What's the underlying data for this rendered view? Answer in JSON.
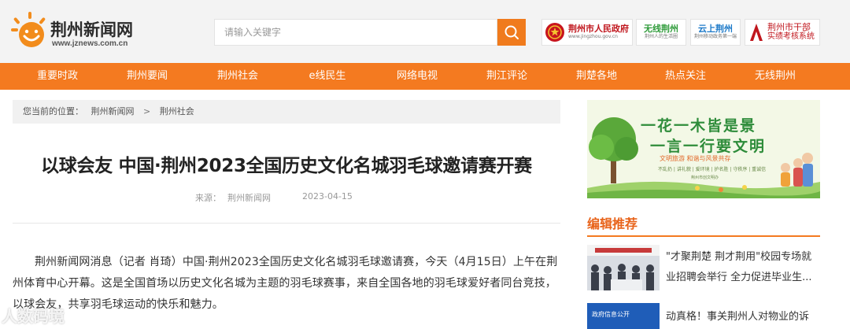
{
  "header": {
    "logo_name": "荆州新闻网",
    "logo_url_text": "www.jznews.com.cn",
    "search_placeholder": "请输入关键字",
    "partners": [
      {
        "name": "荆州市人民政府",
        "sub": "www.jingzhou.gov.cn",
        "color": "#c0161d"
      },
      {
        "name": "无线荆州",
        "sub": "荆州人的生活圈",
        "color": "#2f9b3a"
      },
      {
        "name": "云上荆州",
        "sub": "荆州移动政务第一端",
        "color": "#1c79c8"
      },
      {
        "name": "荆州市干部",
        "name2": "实绩考核系统",
        "color": "#c0161d"
      }
    ]
  },
  "nav": {
    "items": [
      "重要时政",
      "荆州要闻",
      "荆州社会",
      "e线民生",
      "网络电视",
      "荆江评论",
      "荆楚各地",
      "热点关注",
      "无线荆州"
    ]
  },
  "breadcrumb": {
    "prefix": "您当前的位置：",
    "items": [
      "荆州新闻网",
      "荆州社会"
    ],
    "separator": ">"
  },
  "article": {
    "title": "以球会友 中国·荆州2023全国历史文化名城羽毛球邀请赛开赛",
    "source_label": "来源：",
    "source": "荆州新闻网",
    "date": "2023-04-15",
    "paragraph": "荆州新闻网消息（记者 肖琦）中国·荆州2023全国历史文化名城羽毛球邀请赛，今天（4月15日）上午在荆州体育中心开幕。这是全国首场以历史文化名城为主题的羽毛球赛事，来自全国各地的羽毛球爱好者同台竞技，以球会友，共享羽毛球运动的快乐和魅力。"
  },
  "banner": {
    "line1": "一花一木皆是景",
    "line2": "一言一行要文明",
    "line3": "文明旅游 和谐与风景共存",
    "line4": "不乱扔 | 讲礼貌 | 爱环境 | 护名胜 | 守秩序 | 重诚信",
    "line5": "荆州市创文明办"
  },
  "recommend": {
    "title": "编辑推荐",
    "items": [
      {
        "text": "\"才聚荆楚 荆才荆用\"校园专场就业招聘会举行 全力促进毕业生..."
      },
      {
        "text": "动真格！事关荆州人对物业的诉",
        "thumb_label": "政府信息公开"
      }
    ]
  },
  "watermark": "人数码境"
}
